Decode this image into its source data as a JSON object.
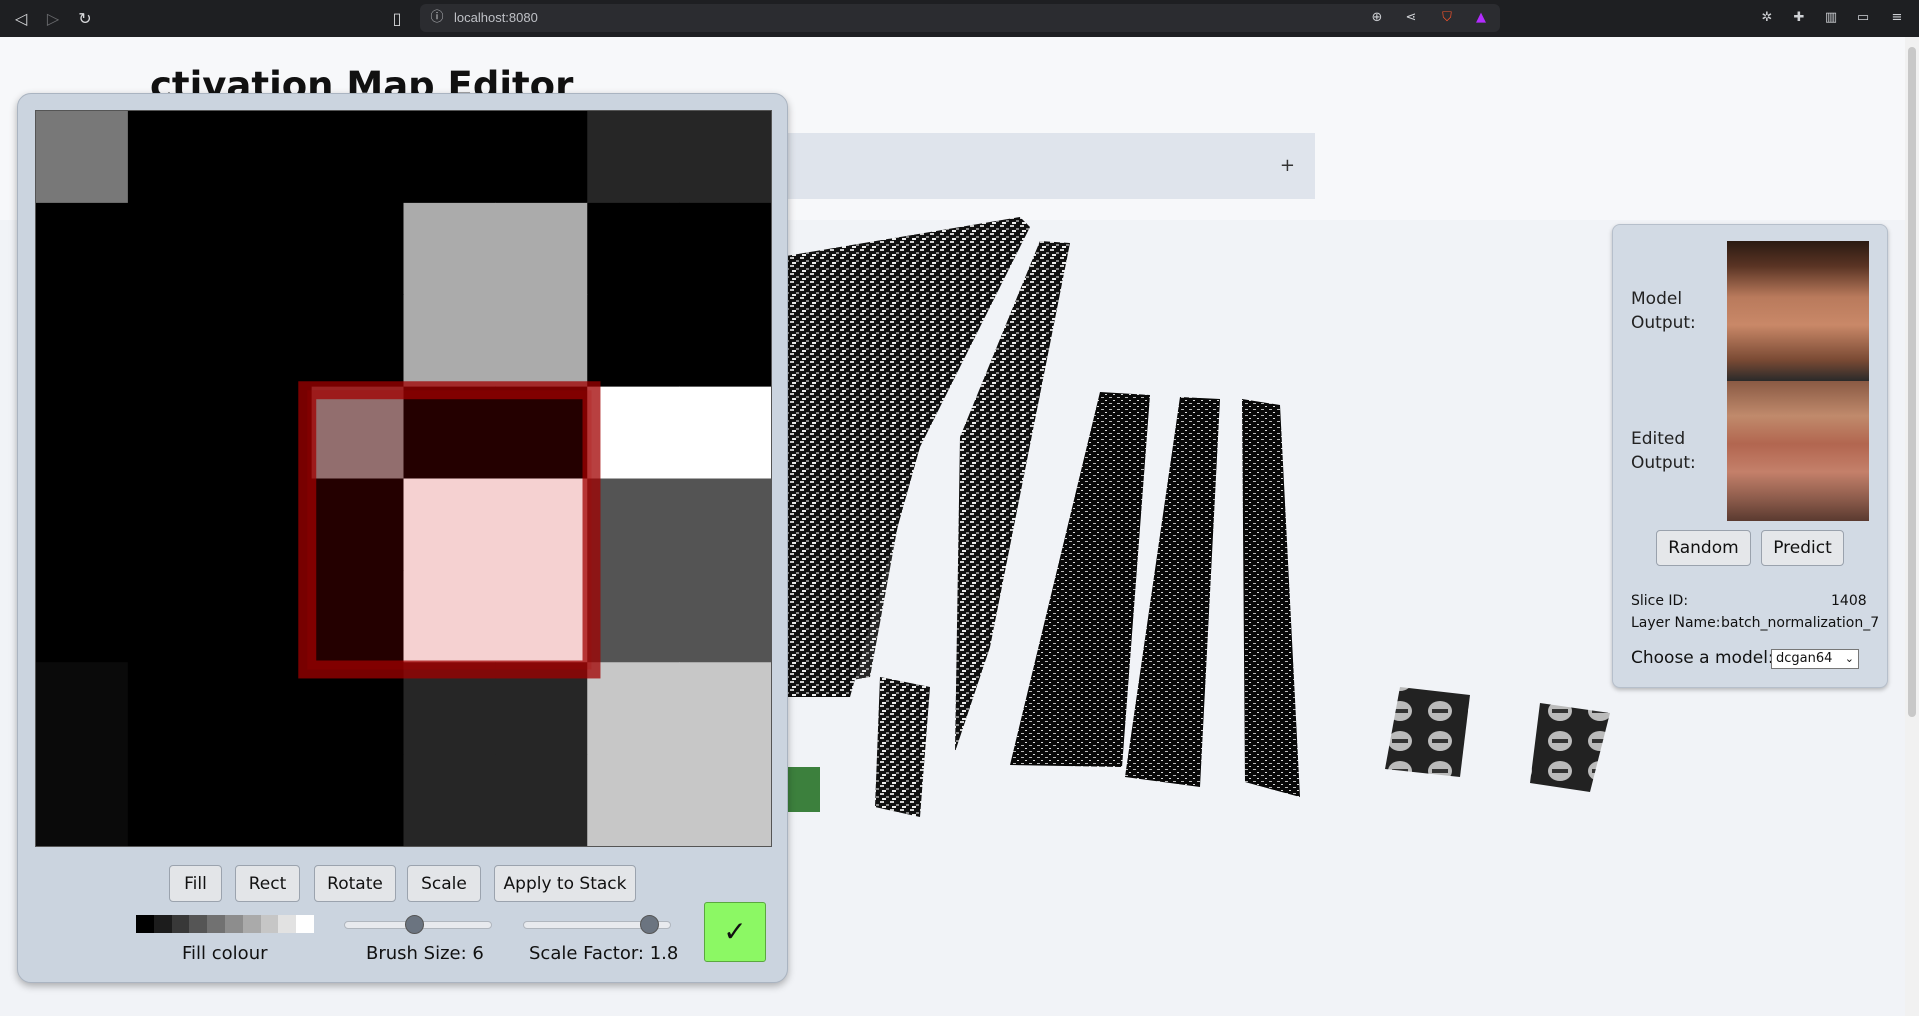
{
  "browser": {
    "url": "localhost:8080",
    "back_icon": "back-arrow-icon",
    "forward_icon": "forward-arrow-icon",
    "reload_icon": "reload-icon"
  },
  "page": {
    "title": "ctivation Map Editor",
    "accordion_toggle": "+"
  },
  "editor": {
    "grid": {
      "cells": [
        [
          0.47,
          0.0,
          0.0,
          0.0,
          0.0,
          0.0,
          0.15,
          0.15
        ],
        [
          0.0,
          0.0,
          0.0,
          0.0,
          0.67,
          0.67,
          0.0,
          0.0
        ],
        [
          0.0,
          0.0,
          0.0,
          0.0,
          0.67,
          0.67,
          0.0,
          0.0
        ],
        [
          0.0,
          0.0,
          0.0,
          0.53,
          0.0,
          0.0,
          1.0,
          1.0
        ],
        [
          0.0,
          0.0,
          0.0,
          0.0,
          1.0,
          1.0,
          0.33,
          0.33
        ],
        [
          0.0,
          0.0,
          0.0,
          0.0,
          1.0,
          1.0,
          0.33,
          0.33
        ],
        [
          0.04,
          0.0,
          0.0,
          0.0,
          0.15,
          0.15,
          0.78,
          0.78
        ],
        [
          0.04,
          0.0,
          0.0,
          0.0,
          0.15,
          0.15,
          0.78,
          0.78
        ]
      ]
    },
    "buttons": {
      "fill": "Fill",
      "rect": "Rect",
      "rotate": "Rotate",
      "scale": "Scale",
      "apply": "Apply to Stack",
      "confirm": "✓"
    },
    "palette": [
      "#000000",
      "#1c1c1c",
      "#383838",
      "#555555",
      "#717171",
      "#8d8d8d",
      "#aaaaaa",
      "#c6c6c6",
      "#e2e2e2",
      "#ffffff"
    ],
    "fill_label": "Fill colour",
    "brush_label": "Brush Size: 6",
    "brush_value": 6,
    "brush_fraction": 0.47,
    "scale_label": "Scale Factor: 1.8",
    "scale_value": 1.8,
    "scale_fraction": 0.85
  },
  "info": {
    "model_output_label": "Model Output:",
    "edited_output_label": "Edited Output:",
    "random_label": "Random",
    "predict_label": "Predict",
    "slice_id_label": "Slice ID:",
    "slice_id": "1408",
    "layer_name_label": "Layer Name:",
    "layer_name": "batch_normalization_7",
    "choose_model_label": "Choose a model:",
    "model_selected": "dcgan64"
  }
}
